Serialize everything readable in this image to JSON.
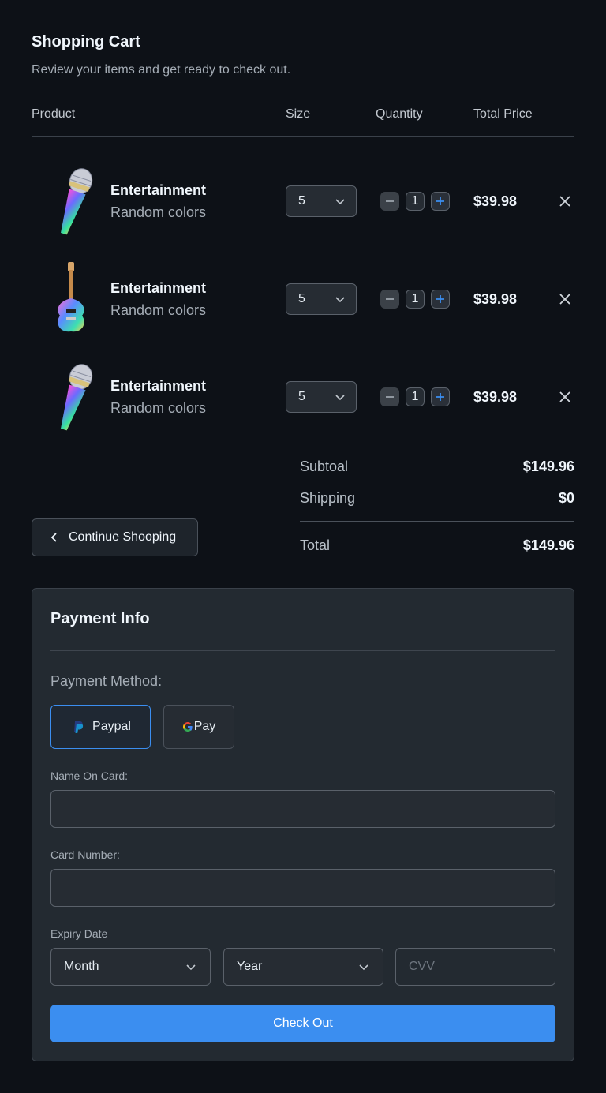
{
  "header": {
    "title": "Shopping Cart",
    "subtitle": "Review your items and get ready to check out."
  },
  "columns": [
    "Product",
    "Size",
    "Quantity",
    "Total Price"
  ],
  "items": [
    {
      "name": "Entertainment",
      "variant": "Random colors",
      "size": "5",
      "quantity": "1",
      "price": "$39.98",
      "image": "microphone-image"
    },
    {
      "name": "Entertainment",
      "variant": "Random colors",
      "size": "5",
      "quantity": "1",
      "price": "$39.98",
      "image": "guitar-image"
    },
    {
      "name": "Entertainment",
      "variant": "Random colors",
      "size": "5",
      "quantity": "1",
      "price": "$39.98",
      "image": "microphone-image"
    }
  ],
  "summary": {
    "subtotal_label": "Subtoal",
    "subtotal_value": "$149.96",
    "shipping_label": "Shipping",
    "shipping_value": "$0",
    "total_label": "Total",
    "total_value": "$149.96"
  },
  "continue_label": "Continue Shooping",
  "payment": {
    "title": "Payment Info",
    "method_label": "Payment Method:",
    "paypal_label": "Paypal",
    "gpay_label": "Pay",
    "name_label": "Name On Card:",
    "card_label": "Card Number:",
    "expiry_label": "Expiry Date",
    "month_value": "Month",
    "year_value": "Year",
    "cvv_placeholder": "CVV",
    "checkout_label": "Check Out"
  },
  "colors": {
    "background": "#0d1117",
    "accent": "#3b8ef0",
    "card": "#232a31"
  }
}
